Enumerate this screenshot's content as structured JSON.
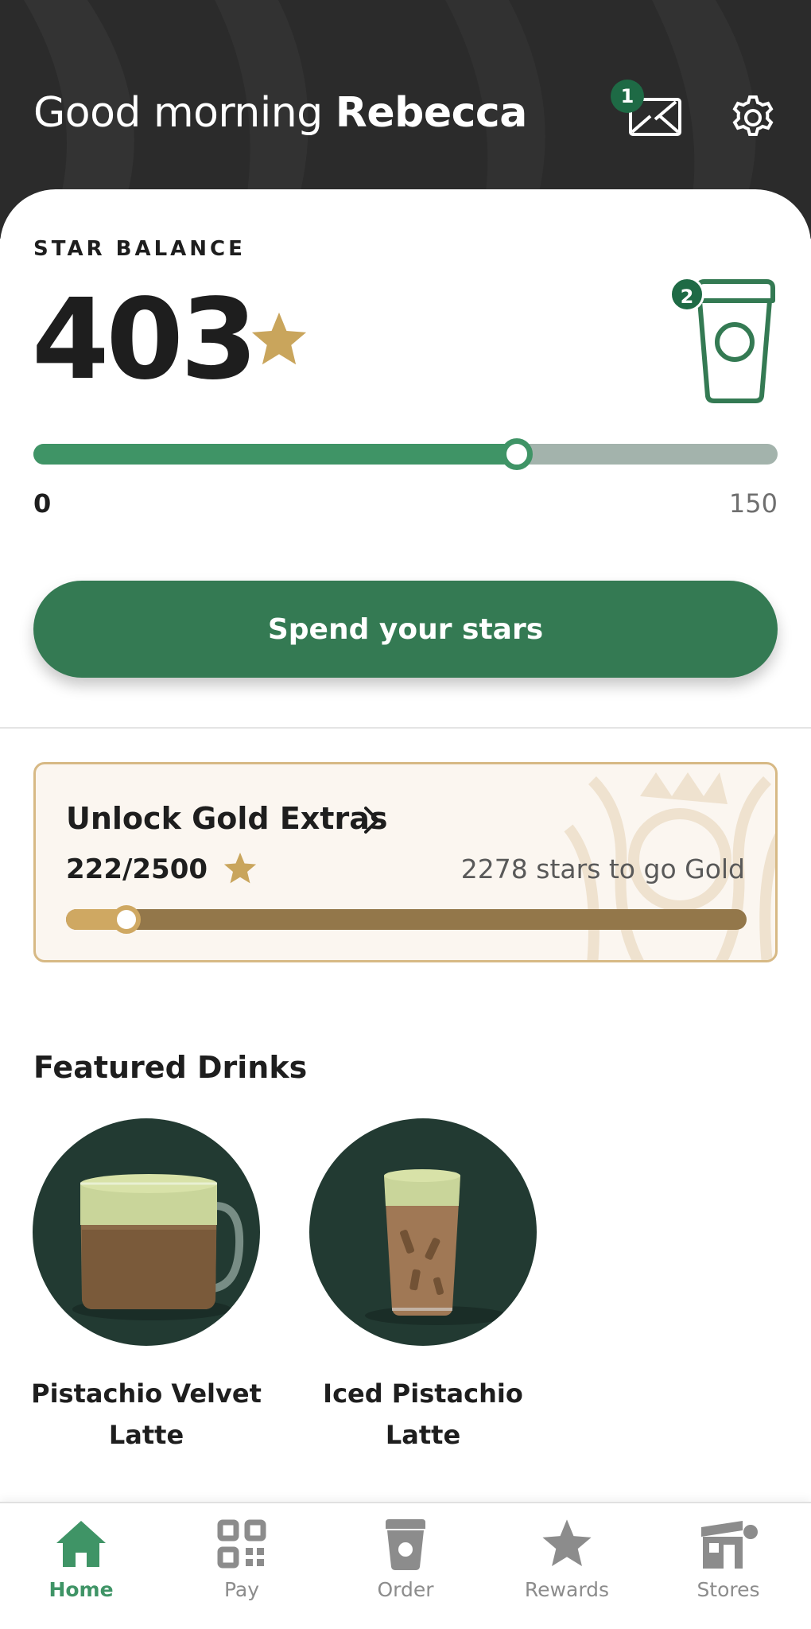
{
  "header": {
    "greeting": "Good morning",
    "user_name": "Rebecca",
    "inbox_badge": "1"
  },
  "star_balance": {
    "label": "STAR BALANCE",
    "count": "403",
    "rewards_badge": "2",
    "progress": {
      "min_label": "0",
      "max_label": "150",
      "fraction": 0.65
    },
    "spend_button": "Spend your stars"
  },
  "gold": {
    "title": "Unlock Gold Extras",
    "progress_text": "222/2500",
    "remaining_text": "2278 stars to go Gold",
    "fraction": 0.0888
  },
  "featured": {
    "title": "Featured Drinks",
    "drinks": [
      {
        "line1": "Pistachio Velvet",
        "line2": "Latte"
      },
      {
        "line1": "Iced Pistachio",
        "line2": "Latte"
      }
    ]
  },
  "nav": {
    "items": [
      {
        "label": "Home",
        "icon": "home-icon",
        "active": true
      },
      {
        "label": "Pay",
        "icon": "qr-code-icon",
        "active": false
      },
      {
        "label": "Order",
        "icon": "cup-icon",
        "active": false
      },
      {
        "label": "Rewards",
        "icon": "star-icon",
        "active": false
      },
      {
        "label": "Stores",
        "icon": "store-icon",
        "active": false
      }
    ]
  },
  "colors": {
    "header_bg": "#2b2b2b",
    "brand_green": "#347a53",
    "progress_green": "#3f9466",
    "star_gold": "#c9a55c",
    "gold_track": "#93774a",
    "nav_active": "#3f9466",
    "nav_inactive": "#8c8c8c"
  }
}
